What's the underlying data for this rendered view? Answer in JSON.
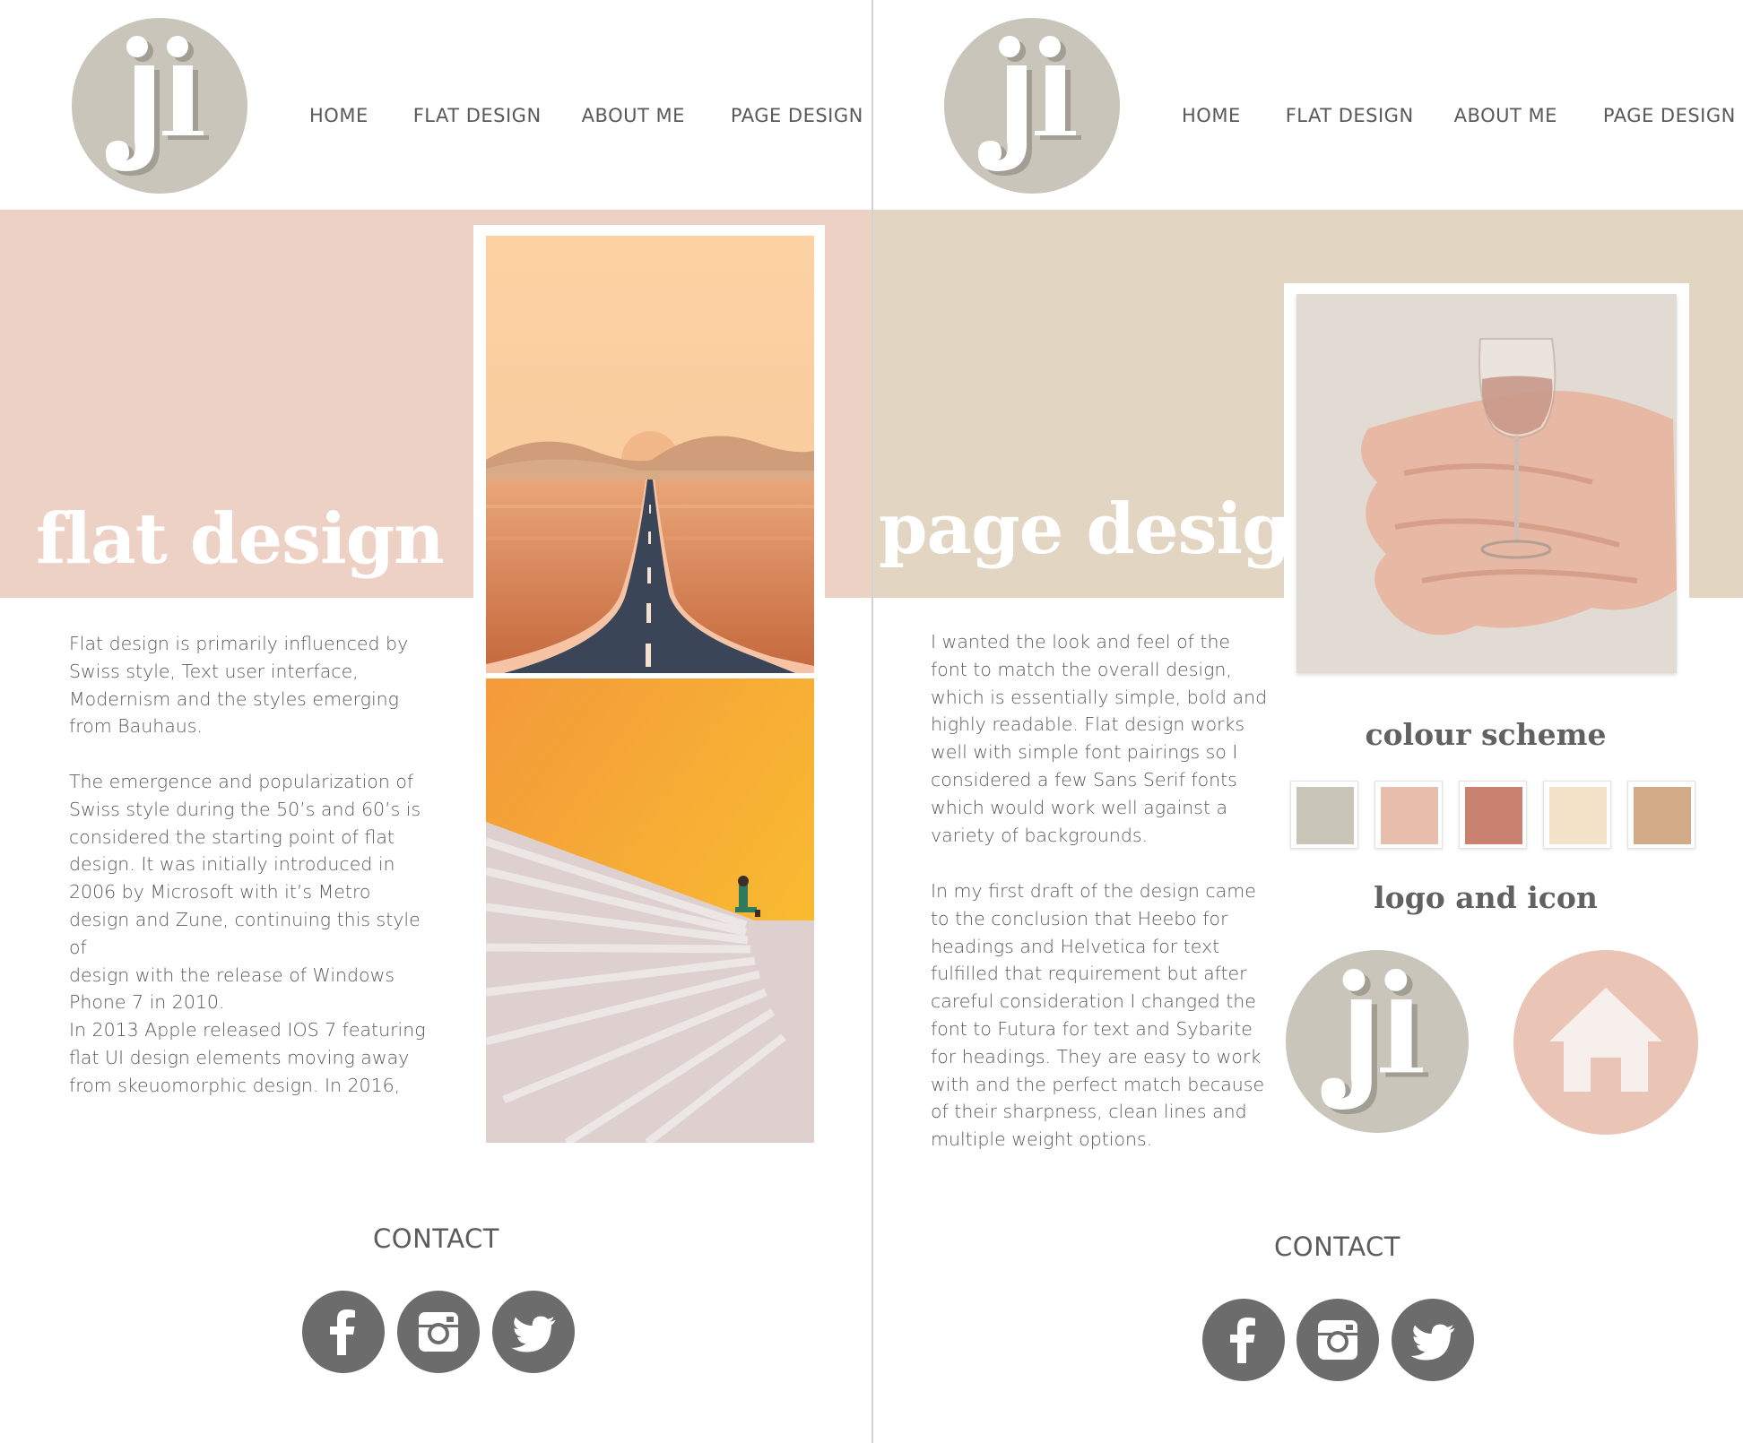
{
  "colors": {
    "logo_bg": "#c9c5ba",
    "left_band": "#edd1c5",
    "right_band": "#e2d5c2",
    "text": "#5a5a5a",
    "social_bg": "#6c6c6c",
    "swatches": [
      "#c9c5b9",
      "#e7bdab",
      "#c8826f",
      "#f2e3c9",
      "#d2ab88"
    ],
    "home_icon_bg": "#eac4b5",
    "home_icon_fg": "#f7efec"
  },
  "logo": {
    "letters": "ji",
    "icon": "ji-monogram-logo"
  },
  "left_page": {
    "nav": [
      "HOME",
      "FLAT DESIGN",
      "ABOUT ME",
      "PAGE DESIGN"
    ],
    "hero_title": "flat design",
    "paragraphs": [
      "Flat design is primarily influenced by\nSwiss style, Text user interface,\nModernism and the styles emerging\nfrom Bauhaus.",
      "The emergence and popularization of\nSwiss style during the 50’s and 60’s is\nconsidered the starting point of flat\ndesign. It was initially introduced in\n2006 by Microsoft with it’s Metro\ndesign and Zune, continuing this style of\ndesign with the release of Windows\nPhone 7 in 2010.",
      "In 2013 Apple released IOS 7 featuring\nflat UI design elements moving away\nfrom skeuomorphic design. In 2016,"
    ],
    "contact_label": "CONTACT",
    "social": [
      "facebook-icon",
      "instagram-icon",
      "twitter-icon"
    ]
  },
  "right_page": {
    "nav": [
      "HOME",
      "FLAT DESIGN",
      "ABOUT ME",
      "PAGE DESIGN"
    ],
    "hero_title": "page design",
    "paragraphs": [
      "I wanted the look and feel of the\nfont to match the overall design,\nwhich is essentially simple, bold and\nhighly readable. Flat design works\nwell with simple font pairings so I\nconsidered a few Sans Serif fonts\nwhich would work well against a\nvariety of backgrounds.",
      "In my first draft of the design  came\nto the conclusion that Heebo for\nheadings and Helvetica for text\nfulfilled that requirement but after\ncareful consideration I changed the\nfont to Futura for text and Sybarite\nfor headings. They are easy to work\nwith and the perfect match because\nof their sharpness, clean lines and\nmultiple weight options."
    ],
    "colour_scheme_heading": "colour scheme",
    "logo_icon_heading": "logo and icon",
    "contact_label": "CONTACT",
    "social": [
      "facebook-icon",
      "instagram-icon",
      "twitter-icon"
    ]
  }
}
